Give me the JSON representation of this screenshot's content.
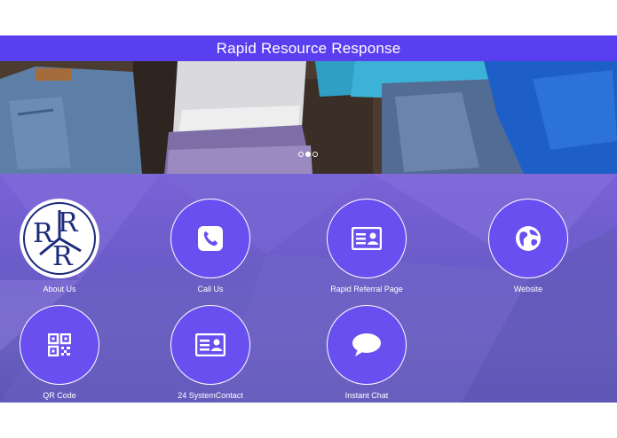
{
  "header": {
    "title": "Rapid Resource Response"
  },
  "carousel": {
    "slide_count": 3,
    "active_index": 1
  },
  "colors": {
    "header": "#5a3ff0",
    "tile": "#6a4ff0",
    "panel": "#6b5cc9"
  },
  "tiles": [
    {
      "label": "About Us",
      "icon": "rrr-logo-icon"
    },
    {
      "label": "Call Us",
      "icon": "phone-icon"
    },
    {
      "label": "Rapid Referral Page",
      "icon": "contact-card-icon"
    },
    {
      "label": "Website",
      "icon": "globe-icon"
    },
    {
      "label": "QR Code",
      "icon": "qr-code-icon"
    },
    {
      "label": "24 SystemContact",
      "icon": "contact-card-icon"
    },
    {
      "label": "Instant Chat",
      "icon": "chat-bubble-icon"
    }
  ]
}
